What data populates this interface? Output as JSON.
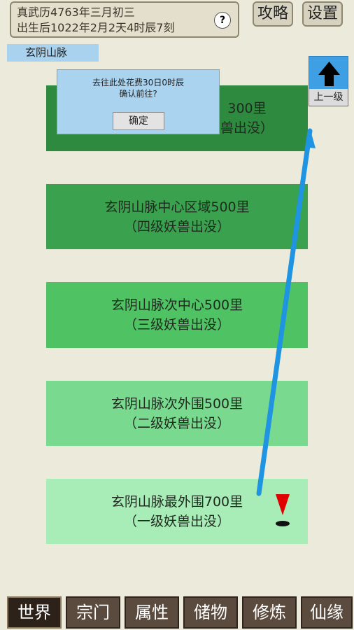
{
  "header": {
    "date_line1": "真武历4763年三月初三",
    "date_line2": "出生后1022年2月2天4时辰7刻",
    "help_label": "?",
    "strategy_label": "攻略",
    "settings_label": "设置"
  },
  "location": {
    "label": "玄阴山脉"
  },
  "up_button": {
    "label": "上一级",
    "icon": "arrow-up-icon"
  },
  "regions": [
    {
      "line1": "300里",
      "line2": "兽出没）",
      "color": "#2e8a3f"
    },
    {
      "line1": "玄阴山脉中心区域500里",
      "line2": "（四级妖兽出没）",
      "color": "#3aa24f"
    },
    {
      "line1": "玄阴山脉次中心500里",
      "line2": "（三级妖兽出没）",
      "color": "#4fc264"
    },
    {
      "line1": "玄阴山脉次外围500里",
      "line2": "（二级妖兽出没）",
      "color": "#79d98e"
    },
    {
      "line1": "玄阴山脉最外围700里",
      "line2": "（一级妖兽出没）",
      "color": "#a8ecb7"
    }
  ],
  "marker": {
    "icon": "location-marker-icon",
    "color": "#e00000"
  },
  "dialog": {
    "line1": "去往此处花费30日0时辰",
    "line2": "确认前往?",
    "confirm_label": "确定"
  },
  "nav": [
    {
      "label": "世界",
      "active": true
    },
    {
      "label": "宗门"
    },
    {
      "label": "属性"
    },
    {
      "label": "储物"
    },
    {
      "label": "修炼"
    },
    {
      "label": "仙缘"
    }
  ]
}
